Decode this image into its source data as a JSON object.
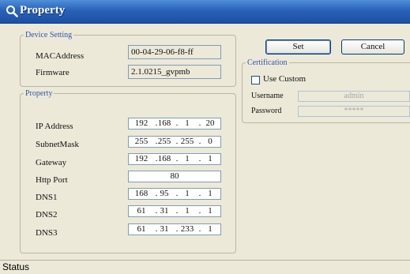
{
  "window": {
    "title": "Property"
  },
  "device_setting": {
    "legend": "Device Setting",
    "mac_label": "MACAddress",
    "mac_value": "00-04-29-06-f8-ff",
    "firmware_label": "Firmware",
    "firmware_value": "2.1.0215_gvpmb"
  },
  "property": {
    "legend": "Property",
    "ip_label": "IP Address",
    "ip": [
      "192",
      "168",
      "1",
      "20"
    ],
    "mask_label": "SubnetMask",
    "mask": [
      "255",
      "255",
      "255",
      "0"
    ],
    "gateway_label": "Gateway",
    "gateway": [
      "192",
      "168",
      "1",
      "1"
    ],
    "http_label": "Http Port",
    "http_port": "80",
    "dns1_label": "DNS1",
    "dns1": [
      "168",
      "95",
      "1",
      "1"
    ],
    "dns2_label": "DNS2",
    "dns2": [
      "61",
      "31",
      "1",
      "1"
    ],
    "dns3_label": "DNS3",
    "dns3": [
      "61",
      "31",
      "233",
      "1"
    ]
  },
  "buttons": {
    "set": "Set",
    "cancel": "Cancel"
  },
  "certification": {
    "legend": "Certification",
    "use_custom_label": "Use Custom",
    "username_label": "Username",
    "username_value": "admin",
    "password_label": "Password",
    "password_value": "*****"
  },
  "status": {
    "text": "Status"
  },
  "colors": {
    "title_bar": "#2a62b8",
    "dialog_bg": "#ece9d8",
    "legend_text": "#3355aa"
  },
  "icons": {
    "title_icon": "magnifier-icon"
  }
}
